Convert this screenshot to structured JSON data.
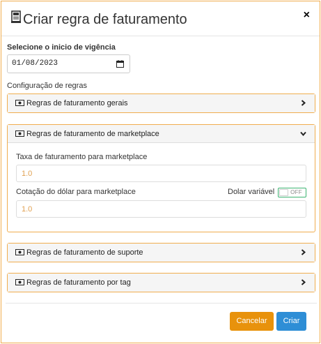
{
  "modal": {
    "title": "Criar regra de faturamento",
    "close_label": "×"
  },
  "start": {
    "label": "Selecione o inicio de vigência",
    "date_value": "01/08/2023"
  },
  "rules": {
    "label": "Configuração de regras",
    "panels": [
      {
        "title": "Regras de faturamento gerais",
        "expanded": false
      },
      {
        "title": "Regras de faturamento de marketplace",
        "expanded": true
      },
      {
        "title": "Regras de faturamento de suporte",
        "expanded": false
      },
      {
        "title": "Regras de faturamento por tag",
        "expanded": false
      }
    ],
    "marketplace": {
      "fee_label": "Taxa de faturamento para marketplace",
      "fee_value": "1.0",
      "dollar_label": "Cotação do dólar para marketplace",
      "dollar_value": "1.0",
      "variable_label": "Dolar variável",
      "toggle_text": "OFF"
    }
  },
  "buttons": {
    "cancel": "Cancelar",
    "create": "Criar"
  },
  "colors": {
    "border_accent": "#f0ad4e",
    "cancel": "#e8920c",
    "create": "#2e8ed6",
    "toggle": "#3cb371"
  }
}
